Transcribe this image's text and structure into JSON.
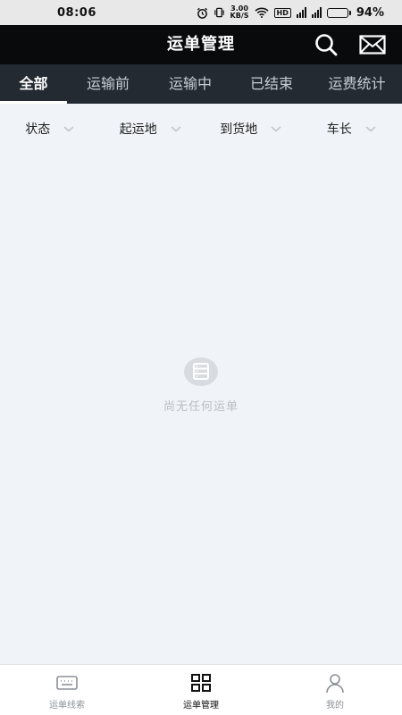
{
  "status_bar": {
    "time": "08:06",
    "net_speed_value": "3.00",
    "net_speed_unit": "KB/S",
    "hd_label": "HD",
    "battery_text": "94%",
    "battery_level": 0.94
  },
  "header": {
    "title": "运单管理",
    "icons": {
      "search": "search-icon",
      "mail": "mail-icon"
    }
  },
  "tabs": [
    {
      "label": "全部",
      "active": true
    },
    {
      "label": "运输前",
      "active": false
    },
    {
      "label": "运输中",
      "active": false
    },
    {
      "label": "已结束",
      "active": false
    },
    {
      "label": "运费统计",
      "active": false
    }
  ],
  "filters": [
    {
      "label": "状态"
    },
    {
      "label": "起运地"
    },
    {
      "label": "到货地"
    },
    {
      "label": "车长"
    }
  ],
  "empty_state": {
    "text": "尚无任何运单",
    "icon": "empty-box-icon"
  },
  "bottom_nav": [
    {
      "label": "运单线索",
      "icon": "keyboard-icon",
      "active": false
    },
    {
      "label": "运单管理",
      "icon": "grid-icon",
      "active": true
    },
    {
      "label": "我的",
      "icon": "person-icon",
      "active": false
    }
  ],
  "colors": {
    "header_bg": "#090a0c",
    "tabs_bg": "#232a32",
    "page_bg": "#f0f3f7",
    "active_text": "#ffffff",
    "inactive_tab_text": "#c8ced6"
  }
}
